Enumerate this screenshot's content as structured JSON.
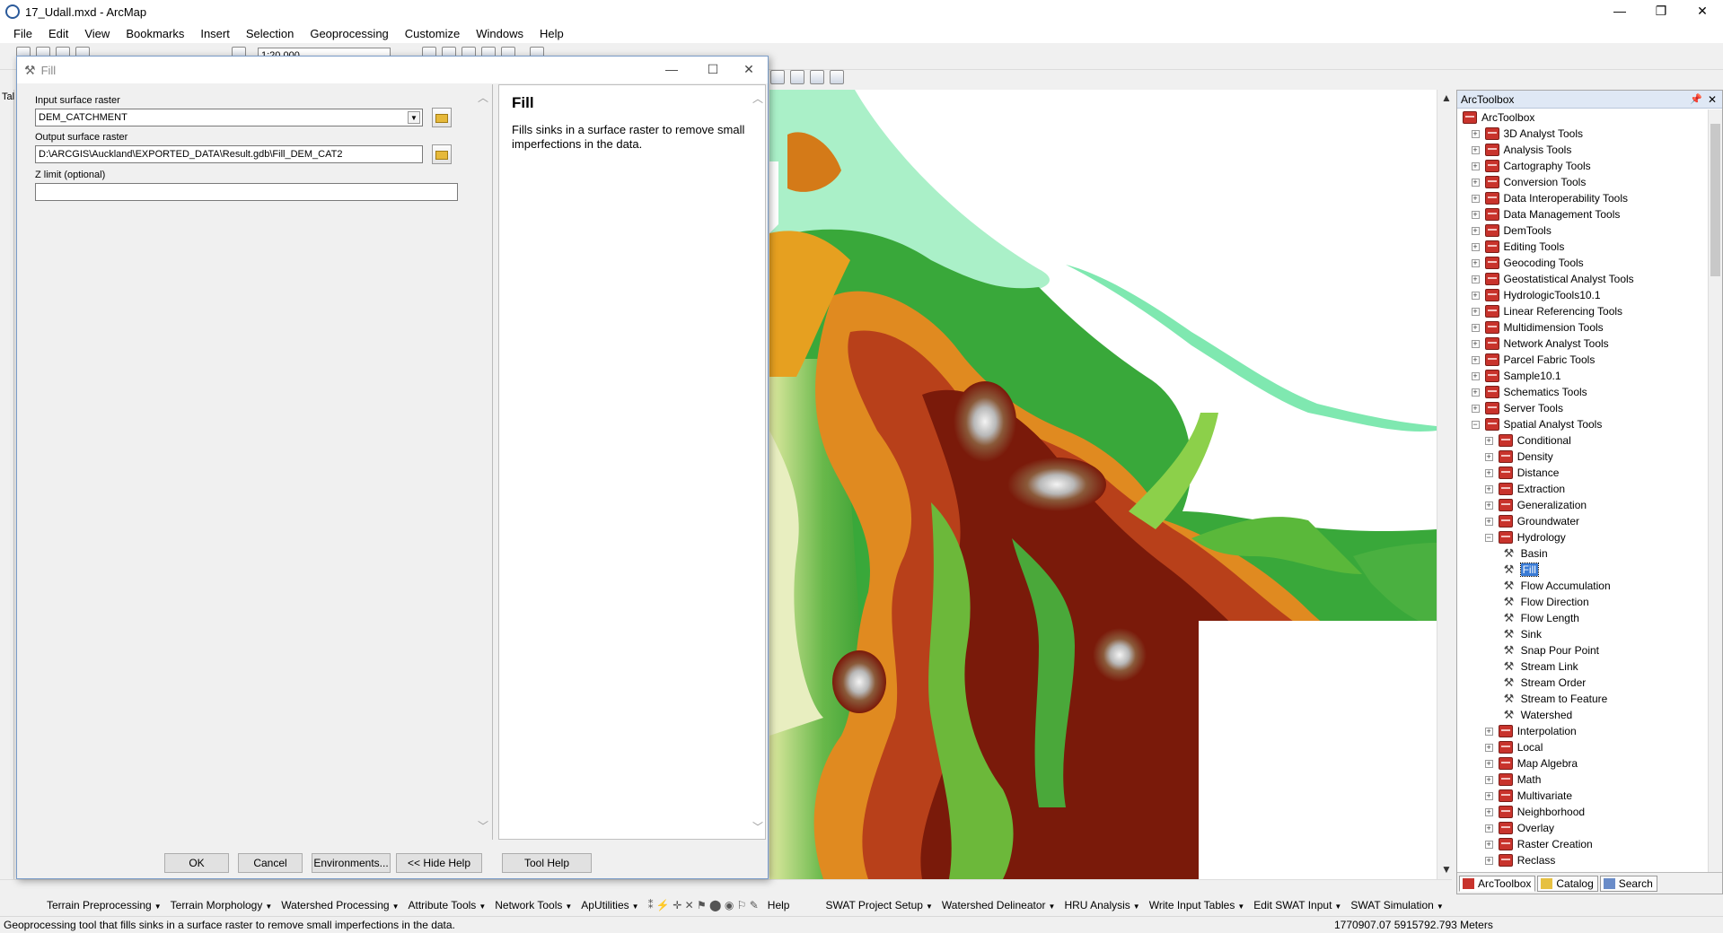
{
  "window": {
    "title": "17_Udall.mxd - ArcMap",
    "minimize": "—",
    "restore": "❐",
    "close": "✕"
  },
  "menu": [
    "File",
    "Edit",
    "View",
    "Bookmarks",
    "Insert",
    "Selection",
    "Geoprocessing",
    "Customize",
    "Windows",
    "Help"
  ],
  "toolbar": {
    "scale": "1:20,000"
  },
  "toc_strip_label": "Tal",
  "dialog": {
    "title": "Fill",
    "params": {
      "input_label": "Input surface raster",
      "input_value": "DEM_CATCHMENT",
      "output_label": "Output surface raster",
      "output_value": "D:\\ARCGIS\\Auckland\\EXPORTED_DATA\\Result.gdb\\Fill_DEM_CAT2",
      "zlimit_label": "Z limit (optional)",
      "zlimit_value": ""
    },
    "help": {
      "title": "Fill",
      "text": "Fills sinks in a surface raster to remove small imperfections in the data."
    },
    "buttons": {
      "ok": "OK",
      "cancel": "Cancel",
      "environments": "Environments...",
      "hide_help": "<< Hide Help",
      "tool_help": "Tool Help"
    }
  },
  "arctoolbox": {
    "header": "ArcToolbox",
    "root": "ArcToolbox",
    "toolboxes": [
      "3D Analyst Tools",
      "Analysis Tools",
      "Cartography Tools",
      "Conversion Tools",
      "Data Interoperability Tools",
      "Data Management Tools",
      "DemTools",
      "Editing Tools",
      "Geocoding Tools",
      "Geostatistical Analyst Tools",
      "HydrologicTools10.1",
      "Linear Referencing Tools",
      "Multidimension Tools",
      "Network Analyst Tools",
      "Parcel Fabric Tools",
      "Sample10.1",
      "Schematics Tools",
      "Server Tools"
    ],
    "spatial_analyst": "Spatial Analyst Tools",
    "sa_before": [
      "Conditional",
      "Density",
      "Distance",
      "Extraction",
      "Generalization",
      "Groundwater"
    ],
    "hydrology": "Hydrology",
    "hydrology_tools": [
      "Basin",
      "Fill",
      "Flow Accumulation",
      "Flow Direction",
      "Flow Length",
      "Sink",
      "Snap Pour Point",
      "Stream Link",
      "Stream Order",
      "Stream to Feature",
      "Watershed"
    ],
    "selected_tool": "Fill",
    "sa_after": [
      "Interpolation",
      "Local",
      "Map Algebra",
      "Math",
      "Multivariate",
      "Neighborhood",
      "Overlay",
      "Raster Creation",
      "Reclass"
    ],
    "tabs": [
      "ArcToolbox",
      "Catalog",
      "Search"
    ]
  },
  "bottom_toolbar": [
    "Terrain Preprocessing",
    "Terrain Morphology",
    "Watershed Processing",
    "Attribute Tools",
    "Network Tools",
    "ApUtilities"
  ],
  "bottom_help": "Help",
  "bottom_toolbar2": [
    "SWAT Project Setup",
    "Watershed Delineator",
    "HRU Analysis",
    "Write Input Tables",
    "Edit SWAT Input",
    "SWAT Simulation"
  ],
  "status": {
    "message": "Geoprocessing tool that fills sinks in a surface raster to remove small imperfections in the data.",
    "coordinates": "1770907.07  5915792.793 Meters"
  }
}
